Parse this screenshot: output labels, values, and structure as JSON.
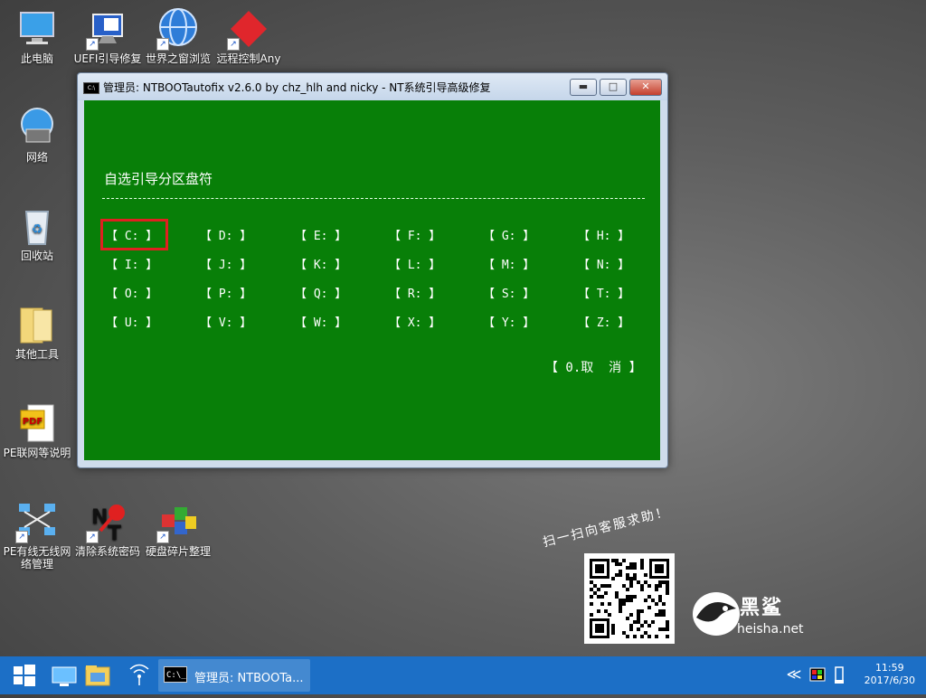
{
  "desktop_icons": [
    {
      "label": "此电脑",
      "icon": "computer-icon"
    },
    {
      "label": "UEFI引导修复",
      "icon": "uefi-repair-icon"
    },
    {
      "label": "世界之窗浏览器",
      "icon": "browser-icon"
    },
    {
      "label": "远程控制AnyDesk",
      "icon": "anydesk-icon"
    },
    {
      "label": "网络",
      "icon": "network-icon"
    },
    {
      "label": "回收站",
      "icon": "recycle-bin-icon"
    },
    {
      "label": "其他工具",
      "icon": "folder-icon"
    },
    {
      "label": "PE联网等说明",
      "icon": "pdf-icon"
    },
    {
      "label": "PE有线无线网络管理",
      "icon": "network-manager-icon"
    },
    {
      "label": "清除系统密码",
      "icon": "password-clear-icon"
    },
    {
      "label": "硬盘碎片整理",
      "icon": "defrag-icon"
    }
  ],
  "console": {
    "title": "管理员:  NTBOOTautofix v2.6.0 by chz_hlh and nicky - NT系统引导高级修复",
    "icon_text": "C:\\",
    "heading": "自选引导分区盘符",
    "drives": [
      [
        "【 C: 】",
        "【 D: 】",
        "【 E: 】",
        "【 F: 】",
        "【 G: 】",
        "【 H: 】"
      ],
      [
        "【 I: 】",
        "【 J: 】",
        "【 K: 】",
        "【 L: 】",
        "【 M: 】",
        "【 N: 】"
      ],
      [
        "【 O: 】",
        "【 P: 】",
        "【 Q: 】",
        "【 R: 】",
        "【 S: 】",
        "【 T: 】"
      ],
      [
        "【 U: 】",
        "【 V: 】",
        "【 W: 】",
        "【 X: 】",
        "【 Y: 】",
        "【 Z: 】"
      ]
    ],
    "selected_drive": "C:",
    "cancel_label": "【 0.取  消 】",
    "minimize_label": "▬",
    "maximize_label": "□",
    "close_label": "✕"
  },
  "promo": {
    "slogan": "扫一扫向客服求助！",
    "brand_name": "黑鲨",
    "brand_url": "heisha.net"
  },
  "taskbar": {
    "task_label": "管理员:  NTBOOTa...",
    "task_icon_text": "C:\\_",
    "time": "11:59",
    "date": "2017/6/30",
    "tray_expand": "≪",
    "color": "#1c6fc6"
  },
  "colors": {
    "console_bg": "#087f08",
    "highlight": "#e02020"
  }
}
